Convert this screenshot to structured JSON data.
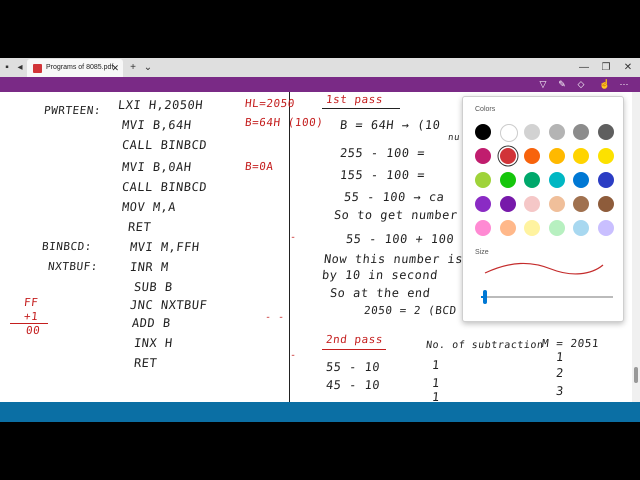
{
  "tabbar": {
    "tab_title": "Programs of 8085.pdf",
    "new_tab": "+",
    "dropdown": "⌄",
    "close_tab": "✕",
    "minimize": "—",
    "restore": "❐",
    "close_window": "✕"
  },
  "toolbar": {
    "highlighter_icon": "▽",
    "pen_icon": "✎",
    "eraser_icon": "◇",
    "touch_icon": "☝",
    "more_icon": "⋯"
  },
  "color_panel": {
    "colors_label": "Colors",
    "size_label": "Size",
    "stroke_color": "#c42b2b",
    "selected_color": "#d13438",
    "size_level": 0.03,
    "swatches": [
      "#000000",
      "#ffffff",
      "#d2d2d2",
      "#b4b4b4",
      "#8c8c8c",
      "#5f5f5f",
      "#c01d6e",
      "#d13438",
      "#f7630c",
      "#ffb900",
      "#ffd400",
      "#fce100",
      "#9fd33a",
      "#16c60c",
      "#00a86b",
      "#00b7c3",
      "#0078d4",
      "#2b3dc4",
      "#8a2bc4",
      "#7719aa",
      "#f5c7c7",
      "#f0bf9a",
      "#a0714f",
      "#8e5c3b",
      "#ff8ad3",
      "#ffb88a",
      "#fff3a0",
      "#b7f0c0",
      "#a8d8f0",
      "#c9bfff"
    ]
  },
  "left_column": [
    {
      "text": "PWRTEEN:",
      "color": "#222"
    },
    {
      "text": "LXI H,2050H",
      "color": "#222"
    },
    {
      "text": "MVI B,64H",
      "color": "#222"
    },
    {
      "text": "CALL BINBCD",
      "color": "#222"
    },
    {
      "text": "MVI B,0AH",
      "color": "#222"
    },
    {
      "text": "CALL BINBCD",
      "color": "#222"
    },
    {
      "text": "MOV M,A",
      "color": "#222"
    },
    {
      "text": "RET",
      "color": "#222"
    },
    {
      "text": "BINBCD:",
      "color": "#222"
    },
    {
      "text": "MVI M,FFH",
      "color": "#222"
    },
    {
      "text": "NXTBUF:",
      "color": "#222"
    },
    {
      "text": "INR M",
      "color": "#222"
    },
    {
      "text": "SUB B",
      "color": "#222"
    },
    {
      "text": "JNC NXTBUF",
      "color": "#222"
    },
    {
      "text": "ADD B",
      "color": "#222"
    },
    {
      "text": "INX H",
      "color": "#222"
    },
    {
      "text": "RET",
      "color": "#222"
    }
  ],
  "red_notes": {
    "hl": "HL=2050",
    "b64": "B=64H (100)",
    "b0a": "B=0A",
    "ff": "FF",
    "plus1": "+1",
    "zero": "00",
    "first_pass": "1st pass",
    "second_pass": "2nd pass"
  },
  "right_column": {
    "b_eq": "B = 64H → (10",
    "nu": "nu",
    "l1": "255 - 100 =",
    "l2": "155 - 100 =",
    "l3": "55 - 100 → ca",
    "l4": "So to get number",
    "l5": "55 - 100 + 100 = 5",
    "l6": "Now this number is",
    "l7": "by 10 in second",
    "l8": "So at the end",
    "l9": "2050 = 2 (BCD",
    "col_a": "No. of subtraction",
    "col_b": "M = 2051",
    "r1": "55 - 10",
    "r2": "45 - 10",
    "n1": "1",
    "n2": "1",
    "n3": "1",
    "m1": "1",
    "m2": "2",
    "m3": "3"
  }
}
